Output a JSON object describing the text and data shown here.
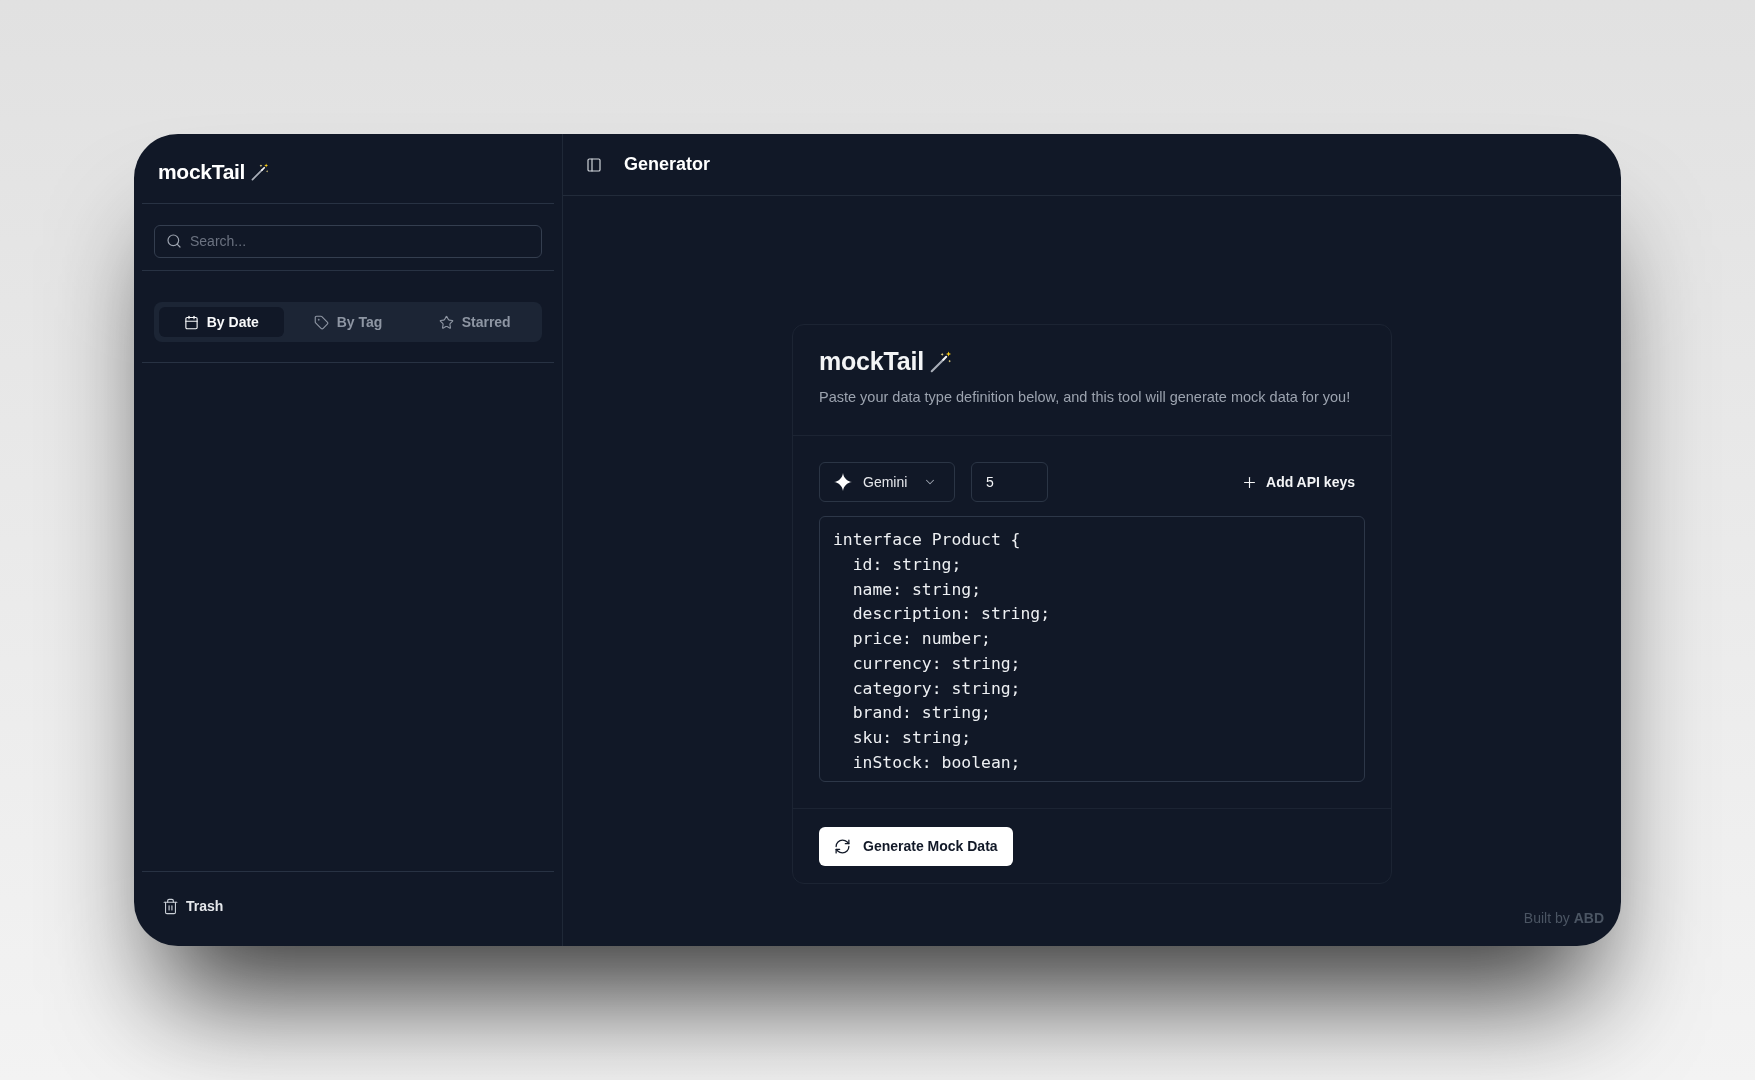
{
  "sidebar": {
    "title": "mockTail",
    "search": {
      "placeholder": "Search..."
    },
    "tabs": [
      {
        "label": "By Date",
        "selected": true
      },
      {
        "label": "By Tag",
        "selected": false
      },
      {
        "label": "Starred",
        "selected": false
      }
    ],
    "trash": {
      "label": "Trash"
    }
  },
  "header": {
    "title": "Generator"
  },
  "card": {
    "title": "mockTail",
    "description": "Paste your data type definition below, and this tool will generate mock data for you!",
    "model_select": {
      "value": "Gemini"
    },
    "count_input": {
      "value": "5"
    },
    "add_keys_button": {
      "label": "Add API keys"
    },
    "editor": {
      "value": "interface Product {\n  id: string;\n  name: string;\n  description: string;\n  price: number;\n  currency: string;\n  category: string;\n  brand: string;\n  sku: string;\n  inStock: boolean;"
    },
    "generate_button": {
      "label": "Generate Mock Data"
    }
  },
  "footer": {
    "credit": "Built by **ABD**"
  }
}
